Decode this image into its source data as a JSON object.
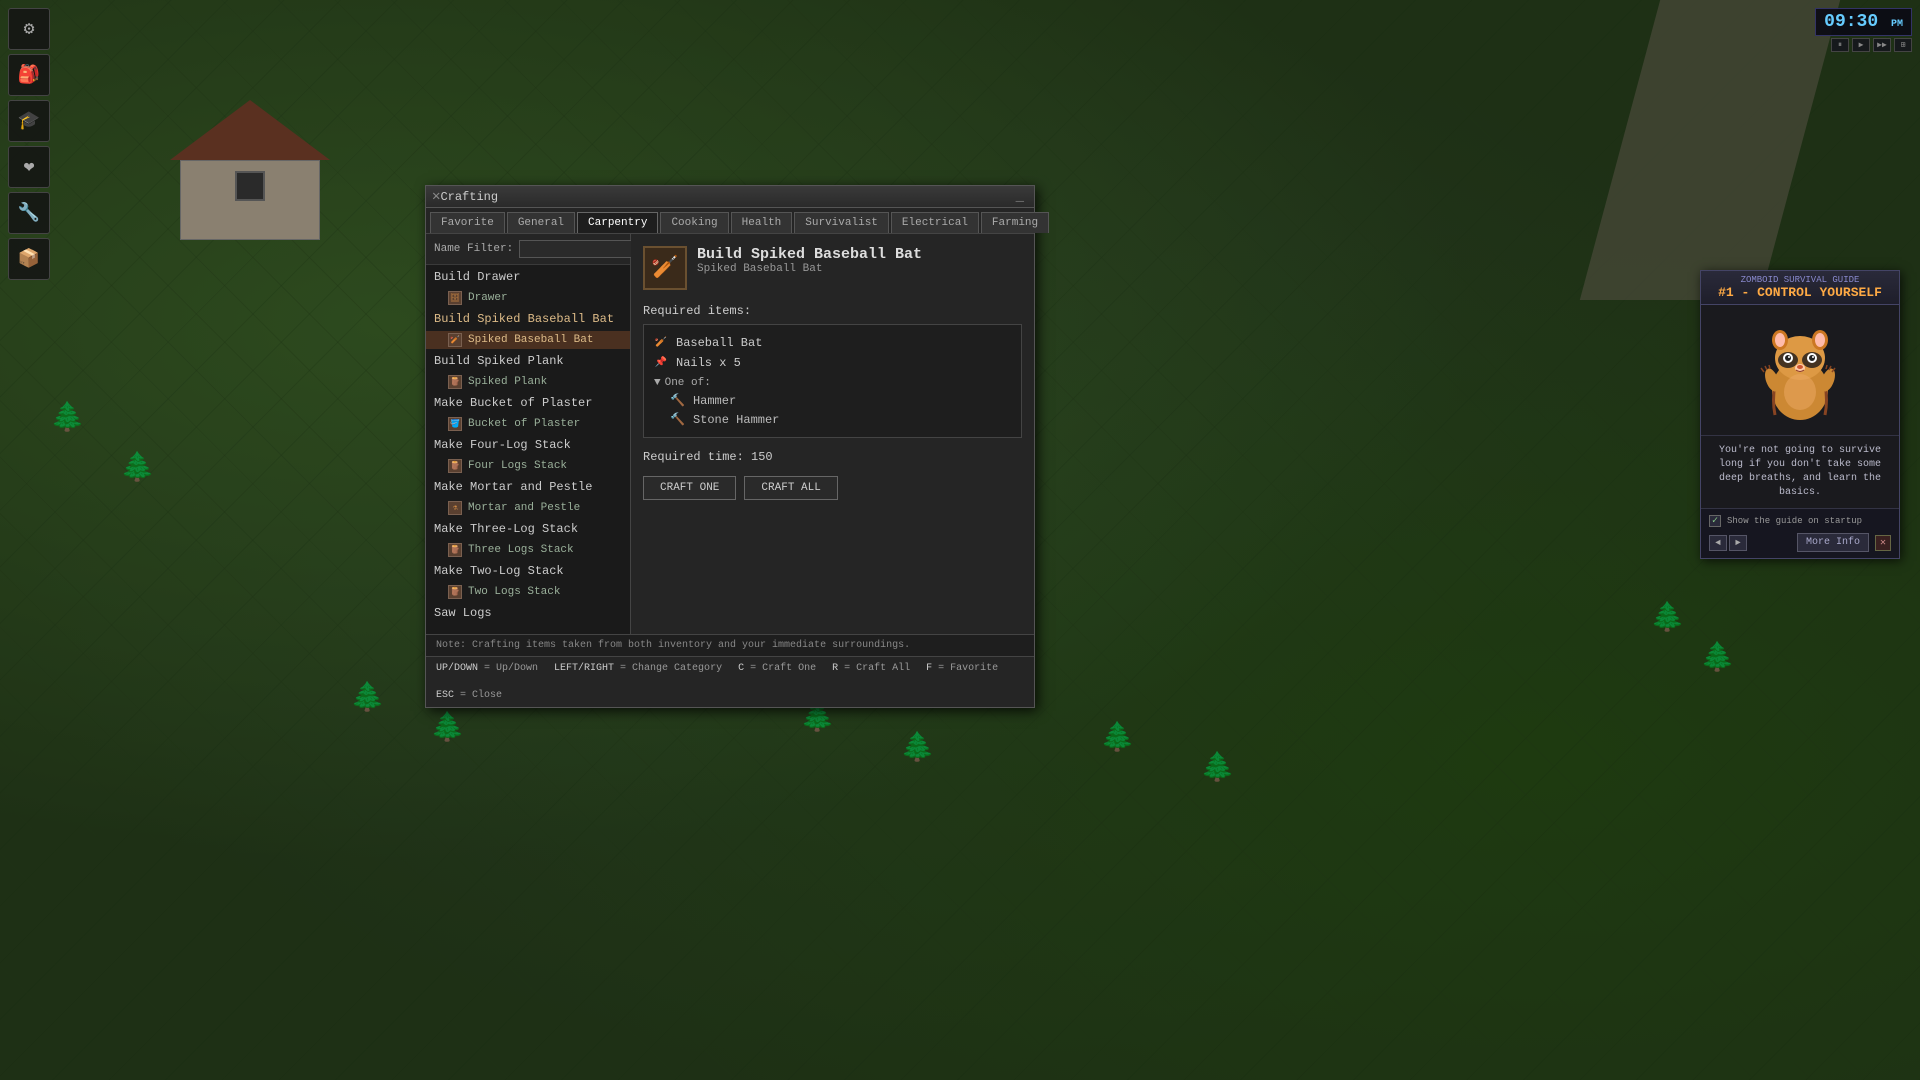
{
  "game": {
    "clock": "09:30",
    "clock_suffix": "PM"
  },
  "hud": {
    "icons": [
      "⚙",
      "🎒",
      "🎓",
      "❤",
      "🔧",
      "📦"
    ]
  },
  "crafting_window": {
    "title": "Crafting",
    "tabs": [
      {
        "label": "Favorite",
        "active": false
      },
      {
        "label": "General",
        "active": false
      },
      {
        "label": "Carpentry",
        "active": true
      },
      {
        "label": "Cooking",
        "active": false
      },
      {
        "label": "Health",
        "active": false
      },
      {
        "label": "Survivalist",
        "active": false
      },
      {
        "label": "Electrical",
        "active": false
      },
      {
        "label": "Farming",
        "active": false
      }
    ],
    "name_filter_label": "Name Filter:",
    "name_filter_value": "",
    "items": [
      {
        "type": "category",
        "label": "Build Drawer",
        "sub": [
          {
            "label": "Drawer"
          }
        ]
      },
      {
        "type": "category",
        "label": "Build Spiked Baseball Bat",
        "selected": true,
        "sub": [
          {
            "label": "Spiked Baseball Bat",
            "selected": true
          }
        ]
      },
      {
        "type": "category",
        "label": "Build Spiked Plank",
        "sub": [
          {
            "label": "Spiked Plank"
          }
        ]
      },
      {
        "type": "category",
        "label": "Make Bucket of Plaster",
        "sub": [
          {
            "label": "Bucket of Plaster"
          }
        ]
      },
      {
        "type": "category",
        "label": "Make Four-Log Stack",
        "sub": [
          {
            "label": "Four Logs Stack"
          }
        ]
      },
      {
        "type": "category",
        "label": "Make Mortar and Pestle",
        "sub": [
          {
            "label": "Mortar and Pestle"
          }
        ]
      },
      {
        "type": "category",
        "label": "Make Three-Log Stack",
        "sub": [
          {
            "label": "Three Logs Stack"
          }
        ]
      },
      {
        "type": "category",
        "label": "Make Two-Log Stack",
        "sub": [
          {
            "label": "Two Logs Stack"
          }
        ]
      },
      {
        "type": "category",
        "label": "Saw Logs",
        "sub": []
      }
    ],
    "recipe": {
      "name": "Build Spiked Baseball Bat",
      "subname": "Spiked Baseball Bat",
      "required_items_label": "Required items:",
      "requirements": [
        {
          "type": "item",
          "label": "Baseball Bat",
          "icon": "🏏"
        },
        {
          "type": "item",
          "label": "Nails x 5",
          "icon": "📌"
        },
        {
          "type": "group_label",
          "label": "One of:"
        },
        {
          "type": "sub_item",
          "label": "Hammer",
          "icon": "🔨"
        },
        {
          "type": "sub_item",
          "label": "Stone Hammer",
          "icon": "🔨"
        }
      ],
      "required_time_label": "Required time:",
      "required_time_value": "150",
      "buttons": {
        "craft_one": "CRAFT ONE",
        "craft_all": "CRAFT ALL"
      }
    },
    "footer_note": "Note: Crafting items taken from both inventory and your immediate surroundings.",
    "hotkeys": [
      {
        "key": "UP/DOWN",
        "desc": "= Up/Down"
      },
      {
        "key": "LEFT/RIGHT",
        "desc": "= Change Category"
      },
      {
        "key": "C",
        "desc": "= Craft One"
      },
      {
        "key": "R",
        "desc": "= Craft All"
      },
      {
        "key": "F",
        "desc": "= Favorite"
      },
      {
        "key": "ESC",
        "desc": "= Close"
      }
    ]
  },
  "guide": {
    "title_line1": "ZOMBOID SURVIVAL GUIDE",
    "title_line2_prefix": "#1 - ",
    "title_line2_main": "CONTROL YOURSELF",
    "body_text": "You're not going to survive long if you don't take some deep breaths, and learn the basics.",
    "checkbox_label": "Show the guide on startup",
    "checkbox_checked": true,
    "nav_prev": "◄",
    "nav_next": "►",
    "more_info": "More Info",
    "close": "✕"
  },
  "media_controls": {
    "buttons": [
      "⏸",
      "►",
      "◄►",
      "⊞"
    ]
  }
}
